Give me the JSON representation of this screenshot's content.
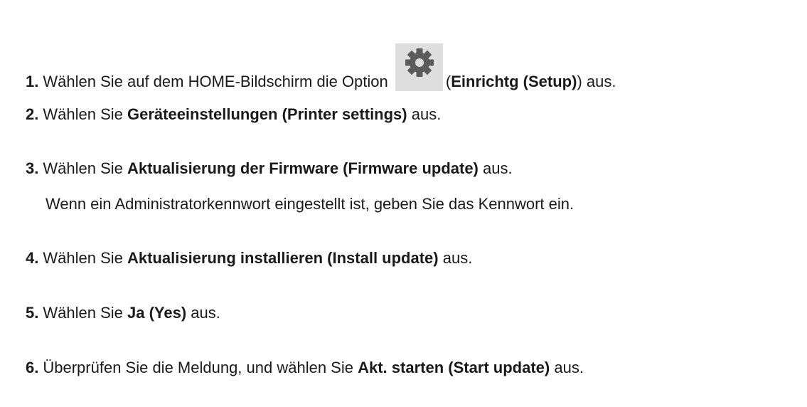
{
  "colors": {
    "text": "#1a1a1a",
    "icon_bg": "#dedede",
    "icon_gear": "#5b5b5b"
  },
  "steps": [
    {
      "num": "1.",
      "pre": "Wählen Sie auf dem HOME-Bildschirm die Option",
      "icon": "gear-icon",
      "open": "(",
      "bold": "Einrichtg (Setup)",
      "post": ") aus."
    },
    {
      "num": "2.",
      "pre": "Wählen Sie ",
      "bold": "Geräteeinstellungen (Printer settings)",
      "post": " aus."
    },
    {
      "num": "3.",
      "pre": "Wählen Sie ",
      "bold": "Aktualisierung der Firmware (Firmware update)",
      "post": " aus.",
      "note": "Wenn ein Administratorkennwort eingestellt ist, geben Sie das Kennwort ein."
    },
    {
      "num": "4.",
      "pre": "Wählen Sie ",
      "bold": "Aktualisierung installieren (Install update)",
      "post": " aus."
    },
    {
      "num": "5.",
      "pre": "Wählen Sie ",
      "bold": "Ja (Yes)",
      "post": " aus."
    },
    {
      "num": "6.",
      "pre": "Überprüfen Sie die Meldung, und wählen Sie ",
      "bold": "Akt. starten (Start update)",
      "post": " aus."
    }
  ]
}
